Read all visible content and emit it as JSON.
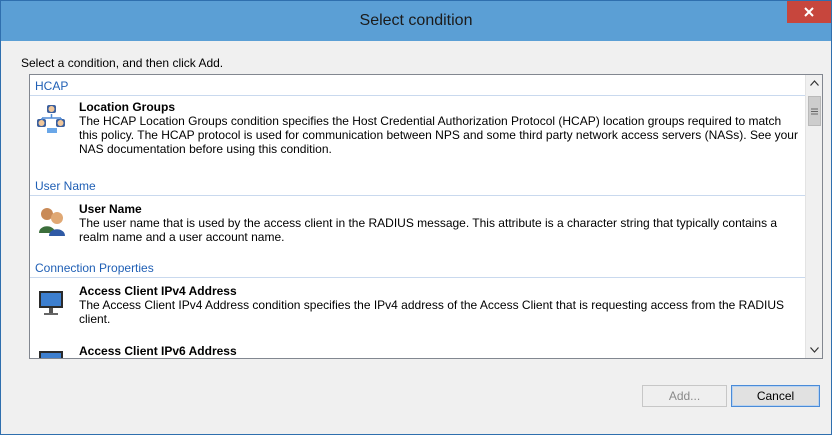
{
  "window": {
    "title": "Select condition",
    "close_label": "x"
  },
  "dialog": {
    "instruction": "Select a condition, and then click Add."
  },
  "groups": [
    {
      "header": "HCAP",
      "items": [
        {
          "title": "Location Groups",
          "icon": "location-groups-icon",
          "desc": "The HCAP Location Groups condition specifies the Host Credential Authorization Protocol (HCAP) location groups required to match this policy. The HCAP protocol is used for communication between NPS and some third party network access servers (NASs). See your NAS documentation before using this condition."
        }
      ]
    },
    {
      "header": "User Name",
      "items": [
        {
          "title": "User Name",
          "icon": "user-name-icon",
          "desc": "The user name that is used by the access client in the RADIUS message. This attribute is a character string that typically contains a realm name and a user account name."
        }
      ]
    },
    {
      "header": "Connection Properties",
      "items": [
        {
          "title": "Access Client IPv4 Address",
          "icon": "computer-icon",
          "desc": "The Access Client IPv4 Address condition specifies the IPv4 address of the Access Client that is requesting access from the RADIUS client."
        },
        {
          "title": "Access Client IPv6 Address",
          "icon": "computer-icon",
          "desc": ""
        }
      ]
    }
  ],
  "buttons": {
    "add": "Add...",
    "cancel": "Cancel"
  },
  "colors": {
    "titlebar": "#5b9fd5",
    "close": "#c7463d",
    "group_header": "#1f5fb5"
  }
}
